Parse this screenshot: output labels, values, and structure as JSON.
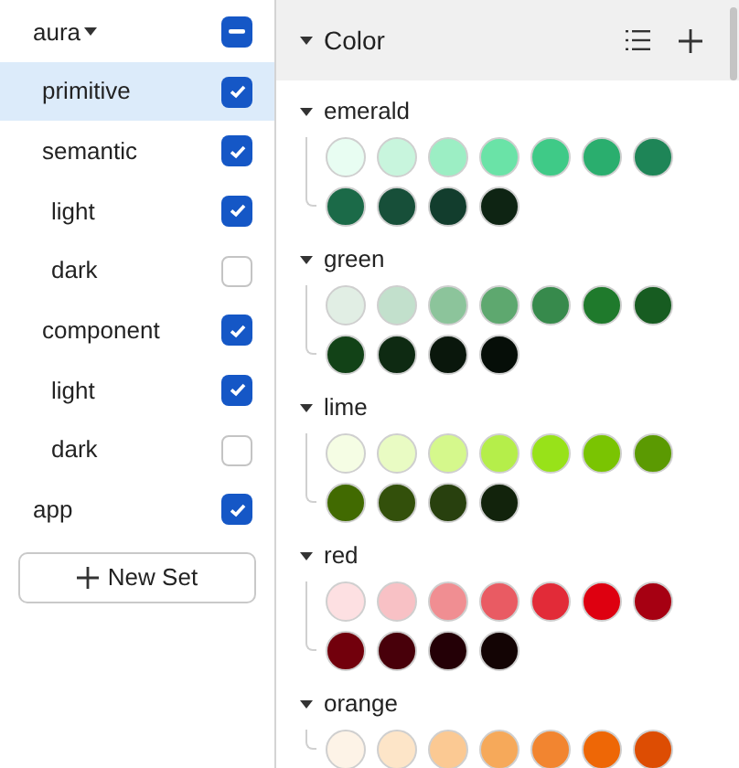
{
  "sets": {
    "tree": [
      {
        "label": "aura",
        "expanded": true,
        "checked": true,
        "indeterminate": true,
        "selected": false,
        "children": [
          {
            "label": "primitive",
            "checked": true,
            "selected": true
          },
          {
            "label": "semantic",
            "checked": true,
            "selected": false,
            "children": [
              {
                "label": "light",
                "checked": true,
                "selected": false
              },
              {
                "label": "dark",
                "checked": false,
                "selected": false
              }
            ]
          },
          {
            "label": "component",
            "checked": true,
            "selected": false,
            "children": [
              {
                "label": "light",
                "checked": true,
                "selected": false
              },
              {
                "label": "dark",
                "checked": false,
                "selected": false
              }
            ]
          }
        ]
      },
      {
        "label": "app",
        "checked": true,
        "selected": false
      }
    ],
    "new_button": "New Set"
  },
  "tokens": {
    "title": "Color",
    "expanded": true,
    "groups": [
      {
        "name": "emerald",
        "expanded": true,
        "swatches": [
          {
            "color": "#e8fdf2"
          },
          {
            "color": "#c8f5dd"
          },
          {
            "color": "#9ceec4"
          },
          {
            "color": "#6ae3a7"
          },
          {
            "color": "#3fca87"
          },
          {
            "color": "#2aae6e"
          },
          {
            "color": "#1e8557"
          },
          {
            "color": "#1b6a48"
          },
          {
            "color": "#174f39"
          },
          {
            "color": "#123d2d"
          },
          {
            "color": "#0e2413"
          }
        ]
      },
      {
        "name": "green",
        "expanded": true,
        "swatches": [
          {
            "color": "#e1eee4"
          },
          {
            "color": "#c2e0cc"
          },
          {
            "color": "#8cc49b"
          },
          {
            "color": "#5ea86f"
          },
          {
            "color": "#378a4c"
          },
          {
            "color": "#1f7a2c"
          },
          {
            "color": "#175c21"
          },
          {
            "color": "#124217"
          },
          {
            "color": "#0e2a12"
          },
          {
            "color": "#0a170c"
          },
          {
            "color": "#060e08"
          }
        ]
      },
      {
        "name": "lime",
        "expanded": true,
        "swatches": [
          {
            "color": "#f5fde4"
          },
          {
            "color": "#e9fbc3"
          },
          {
            "color": "#d5f88c"
          },
          {
            "color": "#b5ee4a"
          },
          {
            "color": "#98e219"
          },
          {
            "color": "#7ac402"
          },
          {
            "color": "#5b9a02"
          },
          {
            "color": "#416a01"
          },
          {
            "color": "#33500b"
          },
          {
            "color": "#28400e"
          },
          {
            "color": "#12230c"
          }
        ]
      },
      {
        "name": "red",
        "expanded": true,
        "swatches": [
          {
            "color": "#fde0e2"
          },
          {
            "color": "#f8c1c5"
          },
          {
            "color": "#f08e92"
          },
          {
            "color": "#e95b63"
          },
          {
            "color": "#e22b38"
          },
          {
            "color": "#de0010"
          },
          {
            "color": "#a60012"
          },
          {
            "color": "#72000c"
          },
          {
            "color": "#48000a"
          },
          {
            "color": "#240006"
          },
          {
            "color": "#130404"
          }
        ]
      },
      {
        "name": "orange",
        "expanded": true,
        "swatches": [
          {
            "color": "#fdf3e7"
          },
          {
            "color": "#fde5c8"
          },
          {
            "color": "#fbc993"
          },
          {
            "color": "#f6a95a"
          },
          {
            "color": "#f28530"
          },
          {
            "color": "#ee6706"
          },
          {
            "color": "#dd4d03"
          }
        ]
      }
    ]
  }
}
